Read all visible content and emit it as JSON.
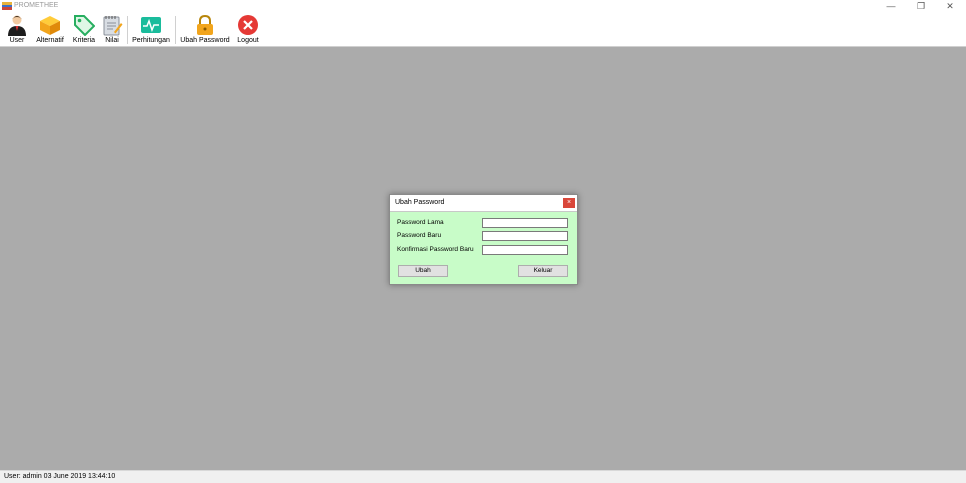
{
  "window": {
    "title": "PROMETHEE",
    "controls": {
      "minimize": "—",
      "restore": "❐",
      "close": "✕"
    }
  },
  "toolbar": {
    "items": [
      {
        "label": "User",
        "icon": "user-icon"
      },
      {
        "label": "Alternatif",
        "icon": "box-icon"
      },
      {
        "label": "Kriteria",
        "icon": "tag-icon"
      },
      {
        "label": "Nilai",
        "icon": "notepad-icon"
      },
      {
        "label": "Perhitungan",
        "icon": "pulse-icon"
      },
      {
        "label": "Ubah Password",
        "icon": "lock-icon"
      },
      {
        "label": "Logout",
        "icon": "close-circle-icon"
      }
    ]
  },
  "dialog": {
    "title": "Ubah Password",
    "close_glyph": "×",
    "fields": [
      {
        "label": "Password Lama",
        "value": ""
      },
      {
        "label": "Password Baru",
        "value": ""
      },
      {
        "label": "Konfirmasi Password Baru",
        "value": ""
      }
    ],
    "buttons": {
      "submit": "Ubah",
      "exit": "Keluar"
    }
  },
  "status": {
    "text": "User: admin  03 June 2019 13:44:10"
  },
  "colors": {
    "workspace": "#ababab",
    "dialog_bg": "#c8fcc8",
    "close_red": "#d9473a"
  }
}
